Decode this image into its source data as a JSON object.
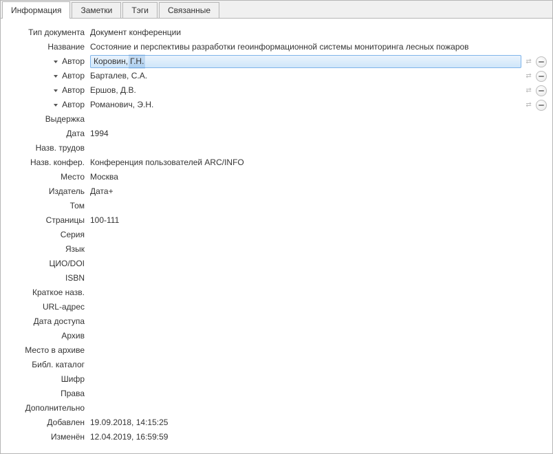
{
  "tabs": {
    "info": "Информация",
    "notes": "Заметки",
    "tags": "Тэги",
    "related": "Связанные"
  },
  "labels": {
    "type": "Тип документа",
    "title": "Название",
    "author": "Автор",
    "abstract": "Выдержка",
    "date": "Дата",
    "proc_title": "Назв. трудов",
    "conf_name": "Назв. конфер.",
    "place": "Место",
    "publisher": "Издатель",
    "volume": "Том",
    "pages": "Страницы",
    "series": "Серия",
    "language": "Язык",
    "doi": "ЦИО/DOI",
    "isbn": "ISBN",
    "short_title": "Краткое назв.",
    "url": "URL-адрес",
    "access_date": "Дата доступа",
    "archive": "Архив",
    "loc_archive": "Место в архиве",
    "lib_catalog": "Библ. каталог",
    "call_no": "Шифр",
    "rights": "Права",
    "extra": "Дополнительно",
    "added": "Добавлен",
    "modified": "Изменён"
  },
  "values": {
    "type": "Документ конференции",
    "title": "Состояние и перспективы разработки геоинформационной системы мониторинга лесных пожаров",
    "date": "1994",
    "conf_name": "Конференция пользователей ARC/INFO",
    "place": "Москва",
    "publisher": "Дата+",
    "pages": "100-111",
    "added": "19.09.2018, 14:15:25",
    "modified": "12.04.2019, 16:59:59"
  },
  "authors": [
    {
      "surname": "Коровин,",
      "given": "Г.Н."
    },
    {
      "display": "Барталев, С.А."
    },
    {
      "display": "Ершов, Д.В."
    },
    {
      "display": "Романович, Э.Н."
    }
  ]
}
